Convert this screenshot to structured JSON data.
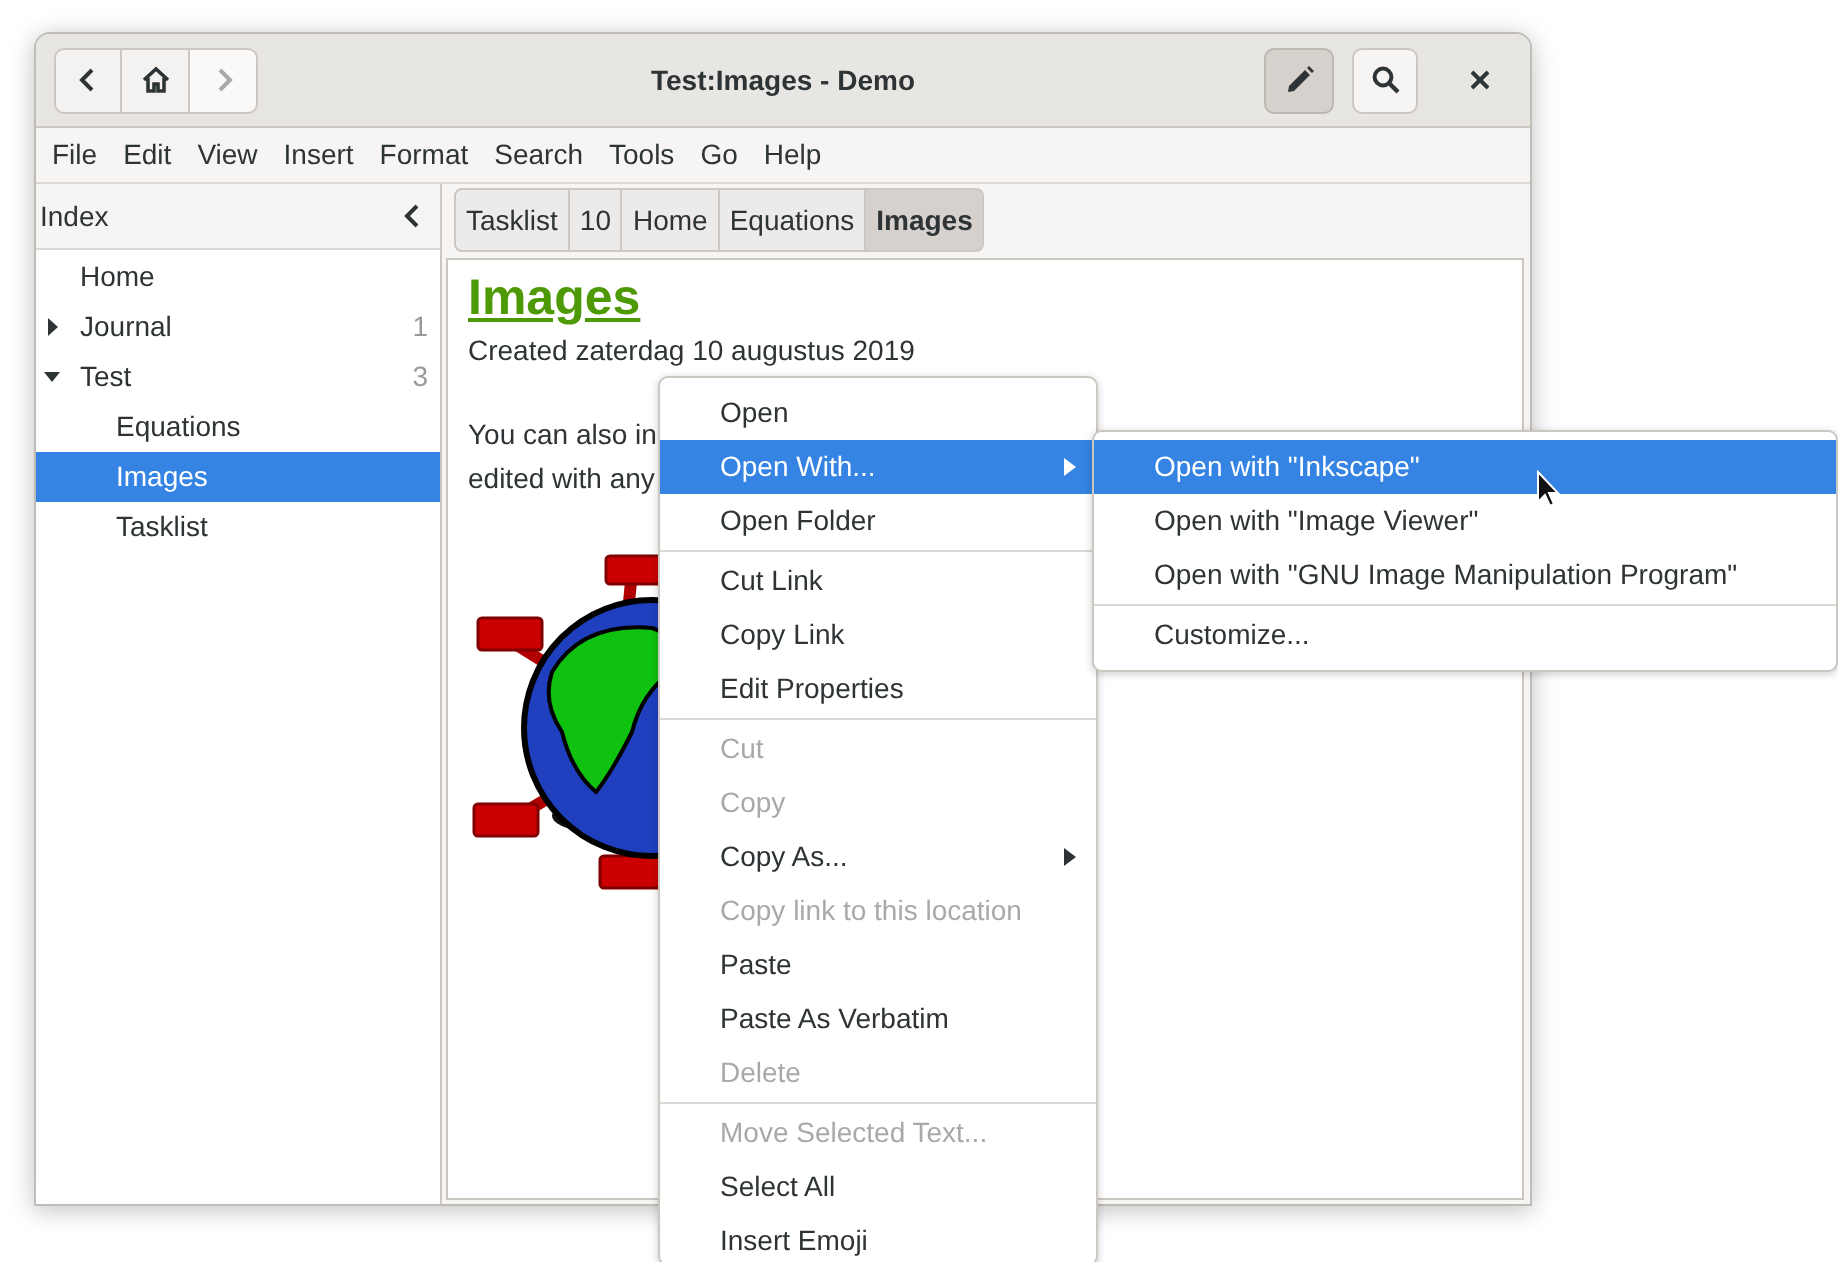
{
  "window": {
    "title": "Test:Images - Demo",
    "nav_buttons": [
      {
        "disabled": false
      },
      {
        "disabled": false
      },
      {
        "disabled": true
      }
    ],
    "edit_toggle": {
      "on": true
    }
  },
  "menu_bar": [
    "File",
    "Edit",
    "View",
    "Insert",
    "Format",
    "Search",
    "Tools",
    "Go",
    "Help"
  ],
  "sidebar": {
    "title": "Index",
    "items": [
      {
        "label": "Home",
        "selected": false
      },
      {
        "label": "Journal",
        "count": "1",
        "expanded": false,
        "selected": false
      },
      {
        "label": "Test",
        "count": "3",
        "expanded": true,
        "selected": false,
        "children": [
          {
            "label": "Equations",
            "selected": false
          },
          {
            "label": "Images",
            "selected": true
          },
          {
            "label": "Tasklist",
            "selected": false
          }
        ]
      }
    ]
  },
  "pathbar": [
    {
      "label": "Tasklist",
      "selected": false
    },
    {
      "label": "10",
      "selected": false
    },
    {
      "label": "Home",
      "selected": false
    },
    {
      "label": "Equations",
      "selected": false
    },
    {
      "label": "Images",
      "selected": true
    }
  ],
  "page": {
    "heading": "Images",
    "created": "Created zaterdag 10 augustus 2019",
    "paragraph_lines": [
      "You can also in",
      "edited with any"
    ]
  },
  "context_menu": [
    {
      "kind": "item",
      "label": "Open",
      "disabled": false,
      "selected": false,
      "submenu": false
    },
    {
      "kind": "item",
      "label": "Open With...",
      "disabled": false,
      "selected": true,
      "submenu": true
    },
    {
      "kind": "item",
      "label": "Open Folder",
      "disabled": false,
      "selected": false,
      "submenu": false
    },
    {
      "kind": "separator"
    },
    {
      "kind": "item",
      "label": "Cut Link",
      "disabled": false,
      "selected": false,
      "submenu": false
    },
    {
      "kind": "item",
      "label": "Copy Link",
      "disabled": false,
      "selected": false,
      "submenu": false
    },
    {
      "kind": "item",
      "label": "Edit Properties",
      "disabled": false,
      "selected": false,
      "submenu": false
    },
    {
      "kind": "separator"
    },
    {
      "kind": "item",
      "label": "Cut",
      "disabled": true,
      "selected": false,
      "submenu": false
    },
    {
      "kind": "item",
      "label": "Copy",
      "disabled": true,
      "selected": false,
      "submenu": false
    },
    {
      "kind": "item",
      "label": "Copy As...",
      "disabled": false,
      "selected": false,
      "submenu": true
    },
    {
      "kind": "item",
      "label": "Copy link to this location",
      "disabled": true,
      "selected": false,
      "submenu": false
    },
    {
      "kind": "item",
      "label": "Paste",
      "disabled": false,
      "selected": false,
      "submenu": false
    },
    {
      "kind": "item",
      "label": "Paste As Verbatim",
      "disabled": false,
      "selected": false,
      "submenu": false
    },
    {
      "kind": "item",
      "label": "Delete",
      "disabled": true,
      "selected": false,
      "submenu": false
    },
    {
      "kind": "separator"
    },
    {
      "kind": "item",
      "label": "Move Selected Text...",
      "disabled": true,
      "selected": false,
      "submenu": false
    },
    {
      "kind": "item",
      "label": "Select All",
      "disabled": false,
      "selected": false,
      "submenu": false
    },
    {
      "kind": "item",
      "label": "Insert Emoji",
      "disabled": false,
      "selected": false,
      "submenu": false
    }
  ],
  "submenu": [
    {
      "kind": "item",
      "label": "Open with \"Inkscape\"",
      "selected": true
    },
    {
      "kind": "item",
      "label": "Open with \"Image Viewer\"",
      "selected": false
    },
    {
      "kind": "item",
      "label": "Open with \"GNU Image Manipulation Program\"",
      "selected": false
    },
    {
      "kind": "separator"
    },
    {
      "kind": "item",
      "label": "Customize...",
      "selected": false
    }
  ]
}
